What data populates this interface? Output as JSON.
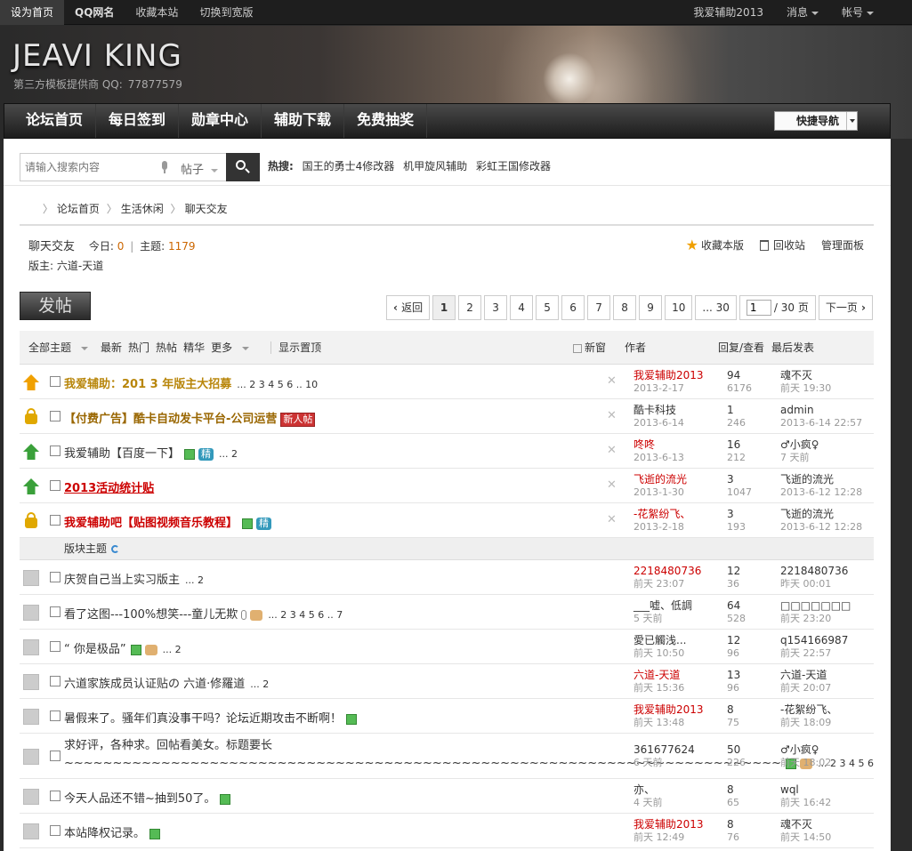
{
  "topbar": {
    "left": [
      "设为首页",
      "QQ网名",
      "收藏本站",
      "切换到宽版"
    ],
    "right": [
      "我爱辅助2013",
      "消息",
      "帐号"
    ]
  },
  "banner": {
    "logo": "JEAVI KING",
    "subtitle": "第三方模板提供商 QQ:",
    "qq": "77877579"
  },
  "nav": {
    "items": [
      "论坛首页",
      "每日签到",
      "勋章中心",
      "辅助下载",
      "免费抽奖"
    ],
    "quick_nav": "快捷导航"
  },
  "search": {
    "placeholder": "请输入搜索内容",
    "type": "帖子",
    "hot_label": "热搜:",
    "hot": [
      "国王的勇士4修改器",
      "机甲旋风辅助",
      "彩虹王国修改器"
    ]
  },
  "breadcrumb": [
    "论坛首页",
    "生活休闲",
    "聊天交友"
  ],
  "forum": {
    "name": "聊天交友",
    "today_label": "今日:",
    "today": "0",
    "topics_label": "主题:",
    "topics": "1179",
    "moderator": "版主: 六道-天道",
    "actions": [
      "收藏本版",
      "回收站",
      "管理面板"
    ]
  },
  "post_button": "发帖",
  "pager": {
    "prev": "返回",
    "pages": [
      "1",
      "2",
      "3",
      "4",
      "5",
      "6",
      "7",
      "8",
      "9",
      "10",
      "... 30"
    ],
    "current": "1",
    "input_value": "1",
    "total": "/ 30 页",
    "next": "下一页"
  },
  "thread_header": {
    "filters": [
      "全部主题",
      "最新",
      "热门",
      "热帖",
      "精华",
      "更多",
      "显示置顶"
    ],
    "new_window": "新窗",
    "author": "作者",
    "stats": "回复/查看",
    "last": "最后发表"
  },
  "section_label": "版块主题",
  "threads_top": [
    {
      "icon": "top3",
      "title": "我爱辅助：201 3 年版主大招募",
      "style": "gold",
      "pages": "... 2  3  4  5  6 .. 10",
      "author": "我爱辅助2013",
      "author_red": true,
      "date": "2013-2-17",
      "replies": "94",
      "views": "6176",
      "last_user": "魂不灭",
      "last_time": "前天 19:30"
    },
    {
      "icon": "lock",
      "title": "【付费广告】酷卡自动发卡平台-公司运营",
      "style": "brown",
      "badge_new": "新人帖",
      "author": "酷卡科技",
      "author_red": false,
      "date": "2013-6-14",
      "replies": "1",
      "views": "246",
      "last_user": "admin",
      "last_time": "2013-6-14 22:57"
    },
    {
      "icon": "top1",
      "title": "我爱辅助【百度一下】",
      "style": "plain",
      "pic": true,
      "jing": "精",
      "pages": "... 2",
      "author": "咚咚",
      "author_red": true,
      "date": "2013-6-13",
      "replies": "16",
      "views": "212",
      "last_user": "♂小疯♀",
      "last_time": "7 天前"
    },
    {
      "icon": "top1",
      "title": "2013活动统计贴",
      "style": "red",
      "author": "飞逝的流光",
      "author_red": true,
      "date": "2013-1-30",
      "replies": "3",
      "views": "1047",
      "last_user": "飞逝的流光",
      "last_time": "2013-6-12 12:28"
    },
    {
      "icon": "lock",
      "title": "我爱辅助吧【贴图视频音乐教程】",
      "style": "redb",
      "pic": true,
      "jing": "精",
      "author": "-花絮纷飞、",
      "author_red": true,
      "date": "2013-2-18",
      "replies": "3",
      "views": "193",
      "last_user": "飞逝的流光",
      "last_time": "2013-6-12 12:28"
    }
  ],
  "threads_normal": [
    {
      "title": "庆贺自己当上实习版主",
      "pages": "... 2",
      "author": "2218480736",
      "author_red": true,
      "date": "前天 23:07",
      "replies": "12",
      "views": "36",
      "last_user": "2218480736",
      "last_time": "昨天 00:01"
    },
    {
      "title": "看了这图---100%想笑---童儿无欺",
      "clip": true,
      "thumb": true,
      "pages": "... 2  3  4  5  6 .. 7",
      "author": "___嘘、低調",
      "author_red": false,
      "date": "5 天前",
      "replies": "64",
      "views": "528",
      "last_user": "□□□□□□□",
      "last_time": "前天 23:20"
    },
    {
      "title": "“ 你是极品”",
      "pic": true,
      "thumb": true,
      "pages": "... 2",
      "author": "愛已觸浅...",
      "author_red": false,
      "date": "前天 10:50",
      "replies": "12",
      "views": "96",
      "last_user": "q154166987",
      "last_time": "前天 22:57"
    },
    {
      "title": "六道家族成员认证贴の 六道·修羅道",
      "pages": "... 2",
      "author": "六道-天道",
      "author_red": true,
      "date": "前天 15:36",
      "replies": "13",
      "views": "96",
      "last_user": "六道-天道",
      "last_time": "前天 20:07"
    },
    {
      "title": "暑假来了。骚年们真没事干吗？论坛近期攻击不断啊！",
      "pic": true,
      "author": "我爱辅助2013",
      "author_red": true,
      "date": "前天 13:48",
      "replies": "8",
      "views": "75",
      "last_user": "-花絮纷飞、",
      "last_time": "前天 18:09"
    },
    {
      "title": "求好评，各种求。回帖看美女。标题要长",
      "title2": "~~~~~~~~~~~~~~~~~~~~~~~~~~~~~~~~~~~~~~~~~~~~~~~~~~~~~~~~~~~~~~~~~~~~~~~~~~",
      "tall": true,
      "pic": true,
      "thumb": true,
      "pages": "... 2  3  4  5  6",
      "author": "361677624",
      "author_red": false,
      "date": "6 天前",
      "replies": "50",
      "views": "226",
      "last_user": "♂小疯♀",
      "last_time": "前天 18:02"
    },
    {
      "title": "今天人品还不错~抽到50了。",
      "pic": true,
      "author": "亦、",
      "author_red": false,
      "date": "4 天前",
      "replies": "8",
      "views": "65",
      "last_user": "wql",
      "last_time": "前天 16:42"
    },
    {
      "title": "本站降权记录。",
      "pic": true,
      "author": "我爱辅助2013",
      "author_red": true,
      "date": "前天 12:49",
      "replies": "8",
      "views": "76",
      "last_user": "魂不灭",
      "last_time": "前天 14:50"
    }
  ]
}
